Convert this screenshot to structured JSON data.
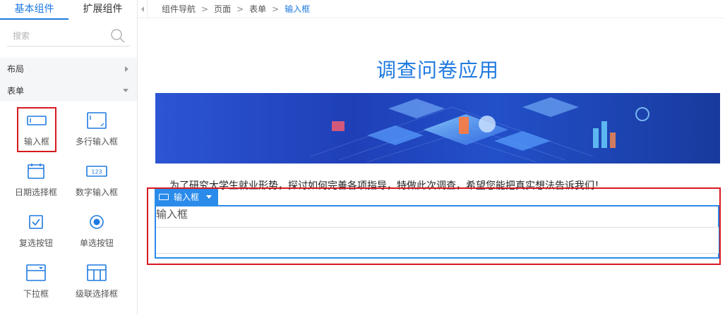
{
  "sidebar": {
    "tabs": [
      {
        "label": "基本组件",
        "active": true
      },
      {
        "label": "扩展组件",
        "active": false
      }
    ],
    "search": {
      "placeholder": "搜索"
    },
    "groups": [
      {
        "label": "布局",
        "expanded": false
      },
      {
        "label": "表单",
        "expanded": true
      }
    ],
    "components": [
      {
        "label": "输入框",
        "icon": "input-box-icon",
        "selected": true
      },
      {
        "label": "多行输入框",
        "icon": "textarea-icon",
        "selected": false
      },
      {
        "label": "日期选择框",
        "icon": "calendar-icon",
        "selected": false
      },
      {
        "label": "数字输入框",
        "icon": "number-input-icon",
        "selected": false
      },
      {
        "label": "复选按钮",
        "icon": "checkbox-icon",
        "selected": false
      },
      {
        "label": "单选按钮",
        "icon": "radio-icon",
        "selected": false
      },
      {
        "label": "下拉框",
        "icon": "dropdown-icon",
        "selected": false
      },
      {
        "label": "级联选择框",
        "icon": "cascader-icon",
        "selected": false
      }
    ],
    "number_icon_text": "123"
  },
  "breadcrumb": {
    "items": [
      "组件导航",
      "页面",
      "表单",
      "输入框"
    ],
    "separator": ">"
  },
  "canvas": {
    "title": "调查问卷应用",
    "intro": "为了研究大学生就业形势，探讨如何完善各项指导，特做此次调查，希望您能把真实想法告诉我们！",
    "selected_component": {
      "tag_label": "输入框",
      "field_label": "输入框",
      "value": ""
    }
  },
  "colors": {
    "accent": "#1f7ae0",
    "selection_red": "#d71920",
    "field_blue": "#2a8bea"
  }
}
